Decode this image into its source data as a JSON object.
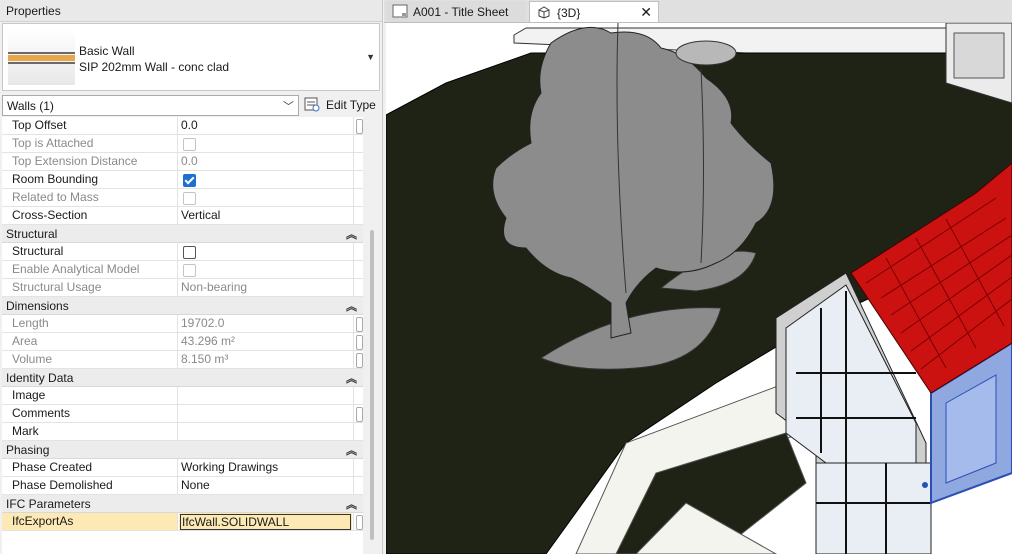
{
  "panel": {
    "title": "Properties",
    "type_family": "Basic Wall",
    "type_name": "SIP 202mm Wall - conc clad",
    "filter": "Walls (1)",
    "edit_type": "Edit Type"
  },
  "groups": {
    "constraints_rows": [
      {
        "name": "Top Offset",
        "value": "0.0"
      },
      {
        "name": "Top is Attached"
      },
      {
        "name": "Top Extension Distance",
        "value": "0.0"
      },
      {
        "name": "Room Bounding",
        "checked": true
      },
      {
        "name": "Related to Mass"
      },
      {
        "name": "Cross-Section",
        "value": "Vertical"
      }
    ],
    "structural": {
      "title": "Structural",
      "rows": [
        {
          "name": "Structural",
          "checked": false
        },
        {
          "name": "Enable Analytical Model"
        },
        {
          "name": "Structural Usage",
          "value": "Non-bearing"
        }
      ]
    },
    "dimensions": {
      "title": "Dimensions",
      "rows": [
        {
          "name": "Length",
          "value": "19702.0"
        },
        {
          "name": "Area",
          "value": "43.296 m²"
        },
        {
          "name": "Volume",
          "value": "8.150 m³"
        }
      ]
    },
    "identity": {
      "title": "Identity Data",
      "rows": [
        {
          "name": "Image",
          "value": ""
        },
        {
          "name": "Comments",
          "value": ""
        },
        {
          "name": "Mark",
          "value": ""
        }
      ]
    },
    "phasing": {
      "title": "Phasing",
      "rows": [
        {
          "name": "Phase Created",
          "value": "Working Drawings"
        },
        {
          "name": "Phase Demolished",
          "value": "None"
        }
      ]
    },
    "ifc": {
      "title": "IFC Parameters",
      "rows": [
        {
          "name": "IfcExportAs",
          "value": "IfcWall.SOLIDWALL"
        }
      ]
    }
  },
  "tabs": [
    {
      "label": "A001 - Title Sheet"
    },
    {
      "label": "{3D}",
      "close": "✕"
    }
  ],
  "colors": {
    "ground": "#1e2315",
    "roof": "#cc1111",
    "selection": "#6b8bd6",
    "tree": "#8c8c8c"
  }
}
